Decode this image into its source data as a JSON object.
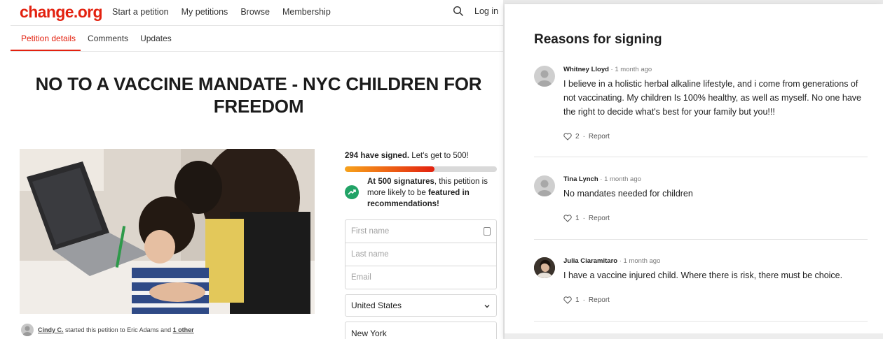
{
  "nav": {
    "logo": "change.org",
    "links": [
      "Start a petition",
      "My petitions",
      "Browse",
      "Membership"
    ],
    "login": "Log in",
    "search_icon": "search-icon"
  },
  "tabs": [
    "Petition details",
    "Comments",
    "Updates"
  ],
  "petition": {
    "title": "NO TO A VACCINE MANDATE - NYC CHILDREN FOR FREEDOM",
    "starter": {
      "name": "Cindy C.",
      "middle": "started this petition to Eric Adams and",
      "other": "1 other"
    }
  },
  "sign": {
    "count_bold": "294 have signed.",
    "count_rest": "Let's get to 500!",
    "progress_fraction": 0.588,
    "boost": {
      "bold1": "At 500 signatures",
      "text1": ", this petition is more likely to be",
      "bold2": "featured in recommendations!"
    },
    "fields": {
      "first_name": "First name",
      "last_name": "Last name",
      "email": "Email",
      "country": "United States",
      "state": "New York"
    },
    "colors": {
      "progress_start": "#f7a21b",
      "progress_end": "#e3210f",
      "boost_icon": "#21a366"
    }
  },
  "reasons": {
    "title": "Reasons for signing",
    "comments": [
      {
        "name": "Whitney Lloyd",
        "time": "1 month ago",
        "text": "I believe in a holistic herbal alkaline lifestyle, and i come from generations of not vaccinating. My children Is 100% healthy, as well as myself. No one have the right to decide what's best for your family but you!!!",
        "likes": "2",
        "report": "Report"
      },
      {
        "name": "Tina Lynch",
        "time": "1 month ago",
        "text": "No mandates needed for children",
        "likes": "1",
        "report": "Report"
      },
      {
        "name": "Julia Ciaramitaro",
        "time": "1 month ago",
        "text": "I have a vaccine injured child. Where there is risk, there must be choice.",
        "likes": "1",
        "report": "Report"
      }
    ]
  },
  "colors": {
    "brand": "#e3210f"
  }
}
